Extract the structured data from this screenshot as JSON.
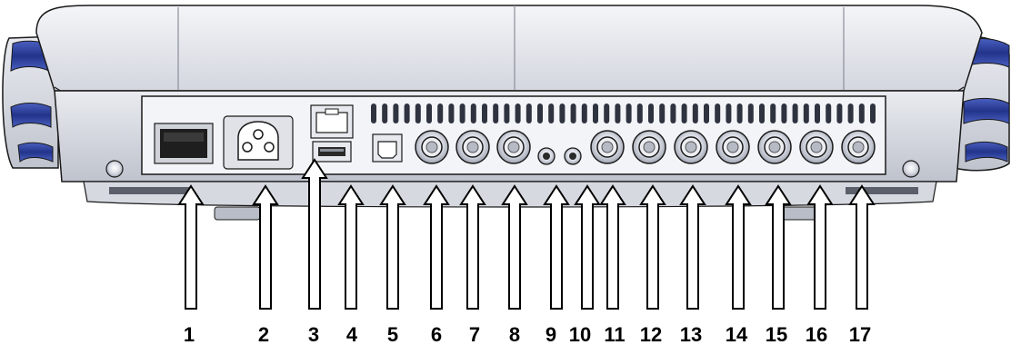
{
  "device": {
    "labels": [
      "1",
      "2",
      "3",
      "4",
      "5",
      "6",
      "7",
      "8",
      "9",
      "10",
      "11",
      "12",
      "13",
      "14",
      "15",
      "16",
      "17"
    ],
    "ports": [
      {
        "id": "1",
        "icon": "power-switch-icon"
      },
      {
        "id": "2",
        "icon": "ac-power-inlet-icon"
      },
      {
        "id": "3",
        "icon": "ethernet-port-icon"
      },
      {
        "id": "4",
        "icon": "usb-a-port-icon"
      },
      {
        "id": "5",
        "icon": "usb-b-port-icon"
      },
      {
        "id": "6",
        "icon": "round-connector-icon"
      },
      {
        "id": "7",
        "icon": "round-connector-icon"
      },
      {
        "id": "8",
        "icon": "round-connector-icon"
      },
      {
        "id": "9",
        "icon": "small-jack-icon"
      },
      {
        "id": "10",
        "icon": "small-jack-icon"
      },
      {
        "id": "11",
        "icon": "round-connector-icon"
      },
      {
        "id": "12",
        "icon": "round-connector-icon"
      },
      {
        "id": "13",
        "icon": "round-connector-icon"
      },
      {
        "id": "14",
        "icon": "round-connector-icon"
      },
      {
        "id": "15",
        "icon": "round-connector-icon"
      },
      {
        "id": "16",
        "icon": "round-connector-icon"
      },
      {
        "id": "17",
        "icon": "round-connector-icon"
      }
    ],
    "colors": {
      "housing": "#e4e6ec",
      "panel": "#f2f3f6",
      "outline": "#1a1a1a",
      "accent_blue": "#2b3f9a",
      "switch": "#222222"
    }
  }
}
